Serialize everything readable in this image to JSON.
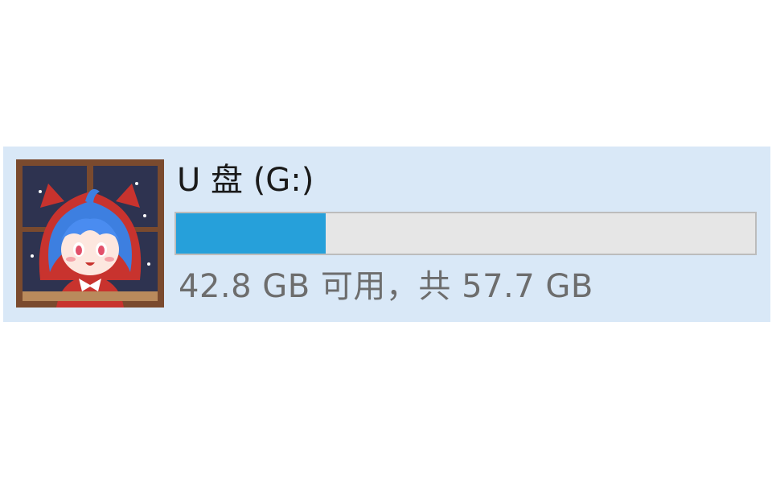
{
  "drive": {
    "title": "U 盘 (G:)",
    "capacity_text": "42.8 GB 可用，共 57.7 GB",
    "used_fraction": 0.258,
    "icon": "drive-thumbnail-anime-avatar",
    "colors": {
      "tile_background": "#d9e8f7",
      "bar_fill": "#26a0da",
      "bar_track": "#e6e6e6"
    }
  }
}
